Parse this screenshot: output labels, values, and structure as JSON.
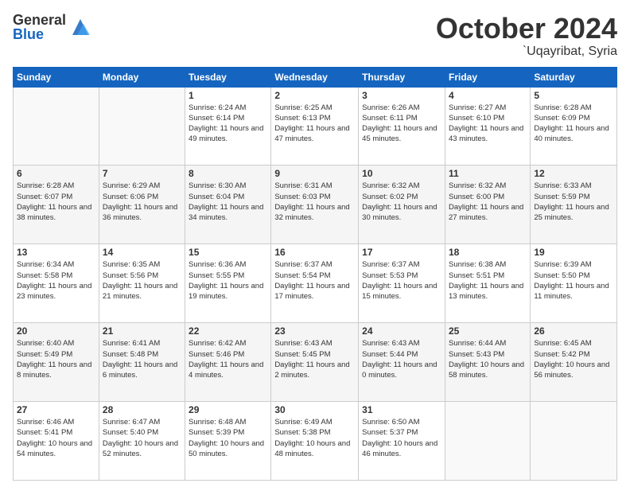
{
  "header": {
    "logo_general": "General",
    "logo_blue": "Blue",
    "month_title": "October 2024",
    "location": "`Uqayribat, Syria"
  },
  "days_of_week": [
    "Sunday",
    "Monday",
    "Tuesday",
    "Wednesday",
    "Thursday",
    "Friday",
    "Saturday"
  ],
  "weeks": [
    [
      {
        "day": "",
        "sunrise": "",
        "sunset": "",
        "daylight": ""
      },
      {
        "day": "",
        "sunrise": "",
        "sunset": "",
        "daylight": ""
      },
      {
        "day": "1",
        "sunrise": "Sunrise: 6:24 AM",
        "sunset": "Sunset: 6:14 PM",
        "daylight": "Daylight: 11 hours and 49 minutes."
      },
      {
        "day": "2",
        "sunrise": "Sunrise: 6:25 AM",
        "sunset": "Sunset: 6:13 PM",
        "daylight": "Daylight: 11 hours and 47 minutes."
      },
      {
        "day": "3",
        "sunrise": "Sunrise: 6:26 AM",
        "sunset": "Sunset: 6:11 PM",
        "daylight": "Daylight: 11 hours and 45 minutes."
      },
      {
        "day": "4",
        "sunrise": "Sunrise: 6:27 AM",
        "sunset": "Sunset: 6:10 PM",
        "daylight": "Daylight: 11 hours and 43 minutes."
      },
      {
        "day": "5",
        "sunrise": "Sunrise: 6:28 AM",
        "sunset": "Sunset: 6:09 PM",
        "daylight": "Daylight: 11 hours and 40 minutes."
      }
    ],
    [
      {
        "day": "6",
        "sunrise": "Sunrise: 6:28 AM",
        "sunset": "Sunset: 6:07 PM",
        "daylight": "Daylight: 11 hours and 38 minutes."
      },
      {
        "day": "7",
        "sunrise": "Sunrise: 6:29 AM",
        "sunset": "Sunset: 6:06 PM",
        "daylight": "Daylight: 11 hours and 36 minutes."
      },
      {
        "day": "8",
        "sunrise": "Sunrise: 6:30 AM",
        "sunset": "Sunset: 6:04 PM",
        "daylight": "Daylight: 11 hours and 34 minutes."
      },
      {
        "day": "9",
        "sunrise": "Sunrise: 6:31 AM",
        "sunset": "Sunset: 6:03 PM",
        "daylight": "Daylight: 11 hours and 32 minutes."
      },
      {
        "day": "10",
        "sunrise": "Sunrise: 6:32 AM",
        "sunset": "Sunset: 6:02 PM",
        "daylight": "Daylight: 11 hours and 30 minutes."
      },
      {
        "day": "11",
        "sunrise": "Sunrise: 6:32 AM",
        "sunset": "Sunset: 6:00 PM",
        "daylight": "Daylight: 11 hours and 27 minutes."
      },
      {
        "day": "12",
        "sunrise": "Sunrise: 6:33 AM",
        "sunset": "Sunset: 5:59 PM",
        "daylight": "Daylight: 11 hours and 25 minutes."
      }
    ],
    [
      {
        "day": "13",
        "sunrise": "Sunrise: 6:34 AM",
        "sunset": "Sunset: 5:58 PM",
        "daylight": "Daylight: 11 hours and 23 minutes."
      },
      {
        "day": "14",
        "sunrise": "Sunrise: 6:35 AM",
        "sunset": "Sunset: 5:56 PM",
        "daylight": "Daylight: 11 hours and 21 minutes."
      },
      {
        "day": "15",
        "sunrise": "Sunrise: 6:36 AM",
        "sunset": "Sunset: 5:55 PM",
        "daylight": "Daylight: 11 hours and 19 minutes."
      },
      {
        "day": "16",
        "sunrise": "Sunrise: 6:37 AM",
        "sunset": "Sunset: 5:54 PM",
        "daylight": "Daylight: 11 hours and 17 minutes."
      },
      {
        "day": "17",
        "sunrise": "Sunrise: 6:37 AM",
        "sunset": "Sunset: 5:53 PM",
        "daylight": "Daylight: 11 hours and 15 minutes."
      },
      {
        "day": "18",
        "sunrise": "Sunrise: 6:38 AM",
        "sunset": "Sunset: 5:51 PM",
        "daylight": "Daylight: 11 hours and 13 minutes."
      },
      {
        "day": "19",
        "sunrise": "Sunrise: 6:39 AM",
        "sunset": "Sunset: 5:50 PM",
        "daylight": "Daylight: 11 hours and 11 minutes."
      }
    ],
    [
      {
        "day": "20",
        "sunrise": "Sunrise: 6:40 AM",
        "sunset": "Sunset: 5:49 PM",
        "daylight": "Daylight: 11 hours and 8 minutes."
      },
      {
        "day": "21",
        "sunrise": "Sunrise: 6:41 AM",
        "sunset": "Sunset: 5:48 PM",
        "daylight": "Daylight: 11 hours and 6 minutes."
      },
      {
        "day": "22",
        "sunrise": "Sunrise: 6:42 AM",
        "sunset": "Sunset: 5:46 PM",
        "daylight": "Daylight: 11 hours and 4 minutes."
      },
      {
        "day": "23",
        "sunrise": "Sunrise: 6:43 AM",
        "sunset": "Sunset: 5:45 PM",
        "daylight": "Daylight: 11 hours and 2 minutes."
      },
      {
        "day": "24",
        "sunrise": "Sunrise: 6:43 AM",
        "sunset": "Sunset: 5:44 PM",
        "daylight": "Daylight: 11 hours and 0 minutes."
      },
      {
        "day": "25",
        "sunrise": "Sunrise: 6:44 AM",
        "sunset": "Sunset: 5:43 PM",
        "daylight": "Daylight: 10 hours and 58 minutes."
      },
      {
        "day": "26",
        "sunrise": "Sunrise: 6:45 AM",
        "sunset": "Sunset: 5:42 PM",
        "daylight": "Daylight: 10 hours and 56 minutes."
      }
    ],
    [
      {
        "day": "27",
        "sunrise": "Sunrise: 6:46 AM",
        "sunset": "Sunset: 5:41 PM",
        "daylight": "Daylight: 10 hours and 54 minutes."
      },
      {
        "day": "28",
        "sunrise": "Sunrise: 6:47 AM",
        "sunset": "Sunset: 5:40 PM",
        "daylight": "Daylight: 10 hours and 52 minutes."
      },
      {
        "day": "29",
        "sunrise": "Sunrise: 6:48 AM",
        "sunset": "Sunset: 5:39 PM",
        "daylight": "Daylight: 10 hours and 50 minutes."
      },
      {
        "day": "30",
        "sunrise": "Sunrise: 6:49 AM",
        "sunset": "Sunset: 5:38 PM",
        "daylight": "Daylight: 10 hours and 48 minutes."
      },
      {
        "day": "31",
        "sunrise": "Sunrise: 6:50 AM",
        "sunset": "Sunset: 5:37 PM",
        "daylight": "Daylight: 10 hours and 46 minutes."
      },
      {
        "day": "",
        "sunrise": "",
        "sunset": "",
        "daylight": ""
      },
      {
        "day": "",
        "sunrise": "",
        "sunset": "",
        "daylight": ""
      }
    ]
  ]
}
